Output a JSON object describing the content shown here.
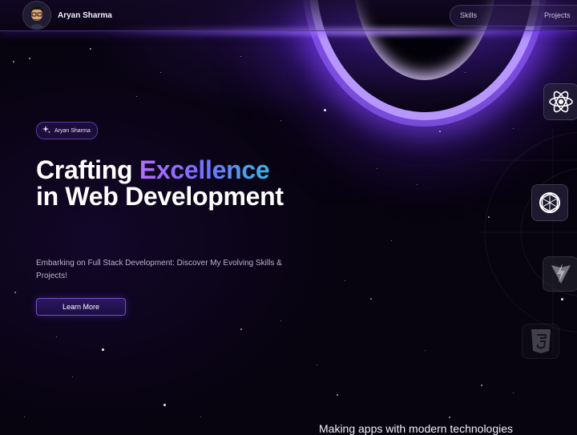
{
  "navbar": {
    "brand_name": "Aryan Sharma",
    "links": [
      {
        "label": "Skills"
      },
      {
        "label": "Projects"
      }
    ]
  },
  "hero": {
    "badge_text": "Aryan Sharma",
    "badge_icon": "sparkles-icon",
    "title_part1": "Crafting ",
    "title_accent": "Excellence",
    "title_part2": "in Web Development",
    "subtitle": "Embarking on Full Stack Development: Discover My Evolving Skills & Projects!",
    "cta_label": "Learn More"
  },
  "tech_icons": [
    "react-icon",
    "openai-icon",
    "vite-icon",
    "css3-icon"
  ],
  "footer_heading": "Making apps with modern technologies",
  "colors": {
    "background": "#07030f",
    "accent_purple": "#b46dff",
    "accent_blue": "#34b7e6",
    "glow": "#7a3cff"
  }
}
